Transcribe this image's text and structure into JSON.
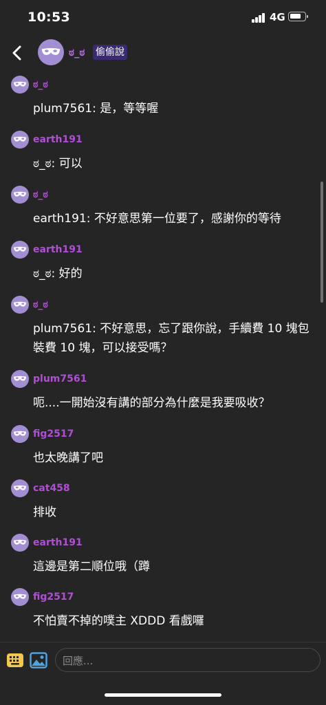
{
  "status": {
    "time": "10:53",
    "network": "4G"
  },
  "header": {
    "title": "ಠ_ಠ",
    "badge": "偷偷說"
  },
  "messages": [
    {
      "author": "ಠ_ಠ",
      "text": "plum7561: 是，等等喔"
    },
    {
      "author": "earth191",
      "text": "ಠ_ಠ: 可以"
    },
    {
      "author": "ಠ_ಠ",
      "text": "earth191: 不好意思第一位要了，感謝你的等待"
    },
    {
      "author": "earth191",
      "text": "ಠ_ಠ: 好的"
    },
    {
      "author": "ಠ_ಠ",
      "text": "plum7561: 不好意思，忘了跟你說，手續費 10 塊包裝費 10 塊，可以接受嗎？"
    },
    {
      "author": "plum7561",
      "text": "呃....一開始沒有講的部分為什麼是我要吸收？"
    },
    {
      "author": "fig2517",
      "text": "也太晚講了吧"
    },
    {
      "author": "cat458",
      "text": "排收"
    },
    {
      "author": "earth191",
      "text": "這邊是第二順位哦（蹲"
    },
    {
      "author": "fig2517",
      "text": "不怕賣不掉的噗主 XDDD 看戲囉"
    }
  ],
  "composer": {
    "placeholder": "回應..."
  },
  "icons": {
    "back": "chevron-left-icon",
    "avatar": "mask-icon",
    "keyboard": "keyboard-icon",
    "image": "image-icon"
  },
  "colors": {
    "background": "#252526",
    "author": "#b04fd6",
    "badge": "#3a2a70",
    "avatar": "#a48ed3",
    "keyboard_icon": "#f2c94c",
    "image_icon": "#4fa3e0"
  }
}
